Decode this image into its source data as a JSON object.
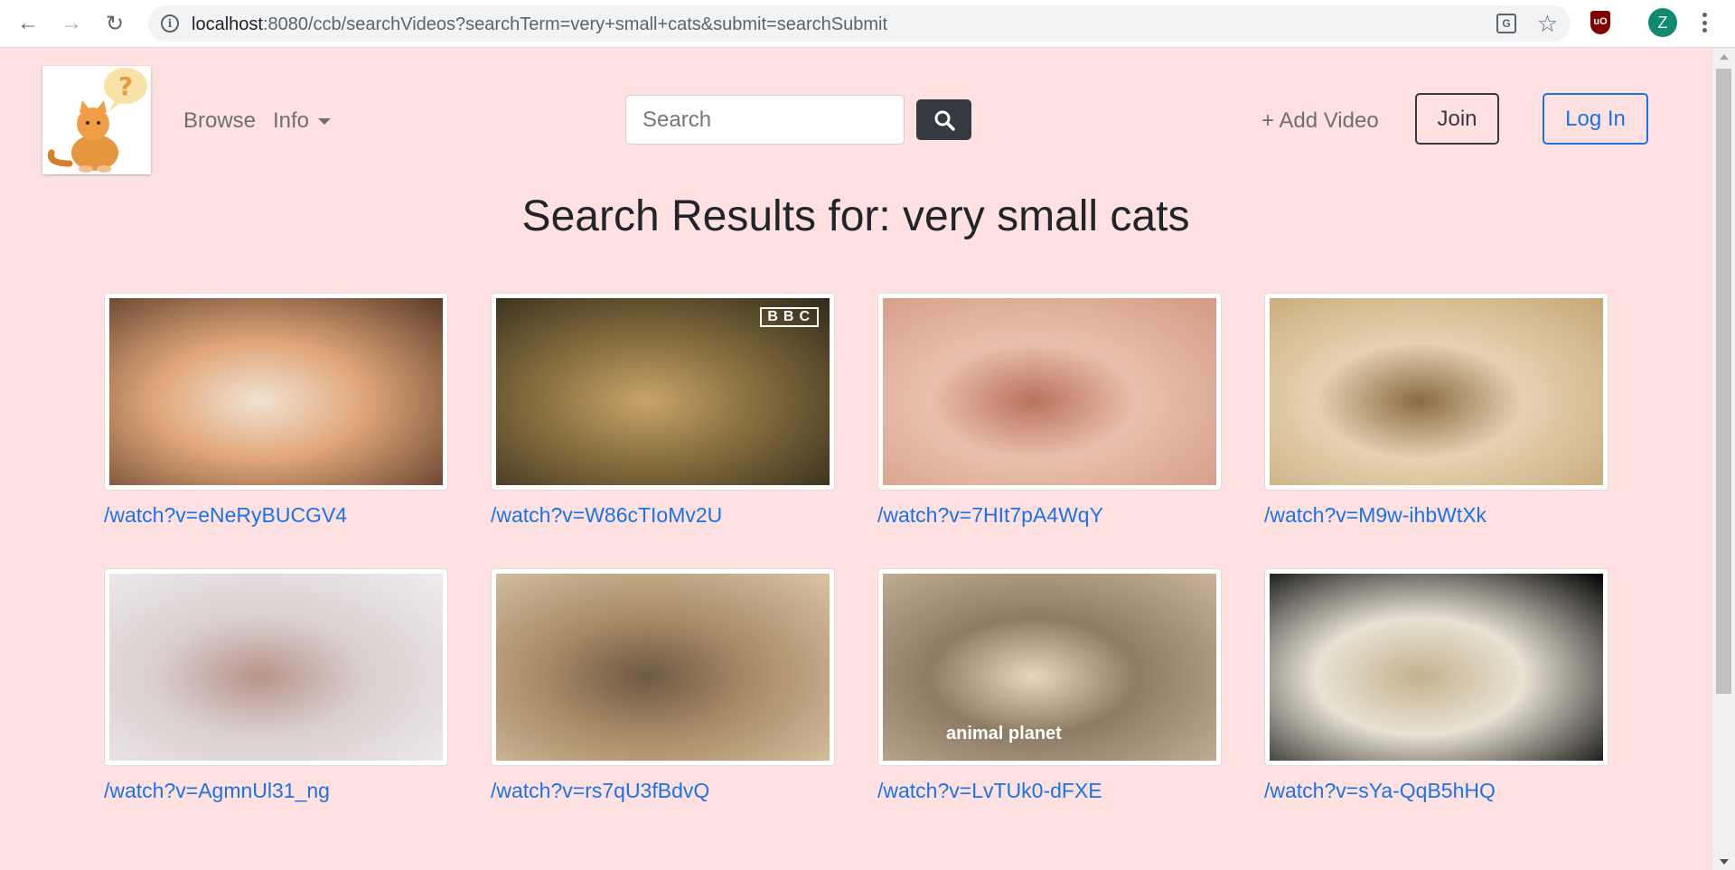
{
  "browser": {
    "url_host": "localhost",
    "url_rest": ":8080/ccb/searchVideos?searchTerm=very+small+cats&submit=searchSubmit",
    "profile_initial": "Z",
    "ext_label": "uO"
  },
  "nav": {
    "browse": "Browse",
    "info": "Info",
    "search_placeholder": "Search",
    "add_video": "+ Add Video",
    "join": "Join",
    "login": "Log In"
  },
  "page_title": "Search Results for: very small cats",
  "videos": [
    {
      "link": "/watch?v=eNeRyBUCGV4",
      "colors": [
        "#5a3a28",
        "#e0a77a",
        "#f2e2d2"
      ]
    },
    {
      "link": "/watch?v=W86cTIoMv2U",
      "colors": [
        "#2f2a1a",
        "#8a7140",
        "#c9a46a"
      ],
      "badge": "BBC"
    },
    {
      "link": "/watch?v=7HIt7pA4WqY",
      "colors": [
        "#d29a84",
        "#e9c0ad",
        "#b9725b"
      ]
    },
    {
      "link": "/watch?v=M9w-ihbWtXk",
      "colors": [
        "#c6a777",
        "#e5d2b0",
        "#8a6b44"
      ]
    },
    {
      "link": "/watch?v=AgmnUl31_ng",
      "colors": [
        "#f0ecec",
        "#d9cfcf",
        "#b99489"
      ]
    },
    {
      "link": "/watch?v=rs7qU3fBdvQ",
      "colors": [
        "#d8c5a6",
        "#a98a66",
        "#6d5a44"
      ]
    },
    {
      "link": "/watch?v=LvTUk0-dFXE",
      "colors": [
        "#c9b49a",
        "#8d7b64",
        "#e9d6bd"
      ],
      "badge": "animal planet"
    },
    {
      "link": "/watch?v=sYa-QqB5hHQ",
      "colors": [
        "#000000",
        "#e8e2d4",
        "#c4b28e"
      ]
    }
  ]
}
